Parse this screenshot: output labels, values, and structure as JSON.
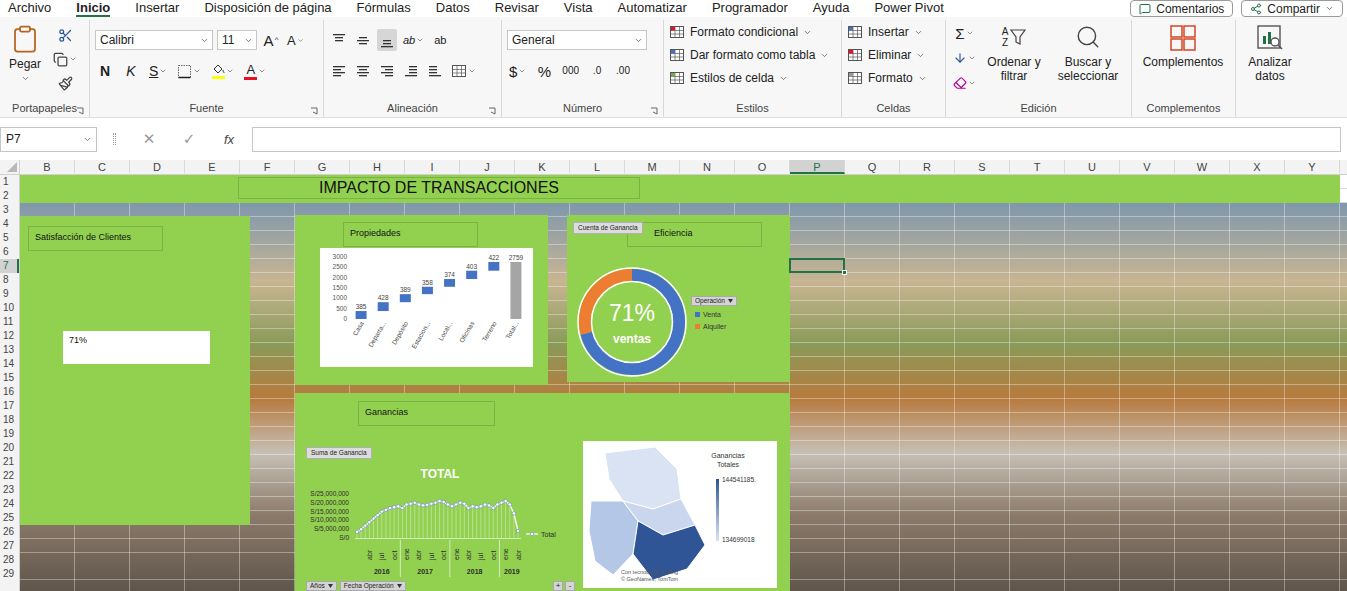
{
  "ribbon_tabs": [
    {
      "label": "Archivo",
      "selected": false
    },
    {
      "label": "Inicio",
      "selected": true
    },
    {
      "label": "Insertar",
      "selected": false
    },
    {
      "label": "Disposición de página",
      "selected": false
    },
    {
      "label": "Fórmulas",
      "selected": false
    },
    {
      "label": "Datos",
      "selected": false
    },
    {
      "label": "Revisar",
      "selected": false
    },
    {
      "label": "Vista",
      "selected": false
    },
    {
      "label": "Automatizar",
      "selected": false
    },
    {
      "label": "Programador",
      "selected": false
    },
    {
      "label": "Ayuda",
      "selected": false
    },
    {
      "label": "Power Pivot",
      "selected": false
    }
  ],
  "top_buttons": [
    "Comentarios",
    "Compartir"
  ],
  "ribbon": {
    "clipboard": {
      "label": "Portapapeles",
      "paste": "Pegar"
    },
    "font": {
      "label": "Fuente",
      "family": "Calibri",
      "size": "11",
      "grow": "A",
      "shrink": "A",
      "bold": "N",
      "italic": "K",
      "underline": "S",
      "color_letter": "A"
    },
    "alignment": {
      "label": "Alineación",
      "orientation": "ab",
      "wrap": "ab"
    },
    "number": {
      "label": "Número",
      "format": "General",
      "currency": "$",
      "percent": "%",
      "thousands": "000",
      "inc_decimal": ".0",
      "dec_decimal": ".00"
    },
    "styles": {
      "label": "Estilos",
      "items": [
        "Formato condicional",
        "Dar formato como tabla",
        "Estilos de celda"
      ]
    },
    "cells": {
      "label": "Celdas",
      "items": [
        "Insertar",
        "Eliminar",
        "Formato"
      ]
    },
    "editing": {
      "label": "Edición",
      "sum": "Σ",
      "sort_letters": [
        "A",
        "Z"
      ],
      "sort": "Ordenar y filtrar",
      "find": "Buscar y seleccionar"
    },
    "addins": {
      "label": "Complementos",
      "button": "Complementos"
    },
    "analyze": {
      "button": "Analizar datos"
    }
  },
  "formula_bar": {
    "name_box": "P7",
    "cancel": "✕",
    "enter": "✓",
    "fx": "fx",
    "value": ""
  },
  "sheet": {
    "columns": [
      {
        "label": "B",
        "selected": false
      },
      {
        "label": "C",
        "selected": false
      },
      {
        "label": "D",
        "selected": false
      },
      {
        "label": "E",
        "selected": false
      },
      {
        "label": "F",
        "selected": false
      },
      {
        "label": "G",
        "selected": false
      },
      {
        "label": "H",
        "selected": false
      },
      {
        "label": "I",
        "selected": false
      },
      {
        "label": "J",
        "selected": false
      },
      {
        "label": "K",
        "selected": false
      },
      {
        "label": "L",
        "selected": false
      },
      {
        "label": "M",
        "selected": false
      },
      {
        "label": "N",
        "selected": false
      },
      {
        "label": "O",
        "selected": false
      },
      {
        "label": "P",
        "selected": true
      },
      {
        "label": "Q",
        "selected": false
      },
      {
        "label": "R",
        "selected": false
      },
      {
        "label": "S",
        "selected": false
      },
      {
        "label": "T",
        "selected": false
      },
      {
        "label": "U",
        "selected": false
      },
      {
        "label": "V",
        "selected": false
      },
      {
        "label": "W",
        "selected": false
      },
      {
        "label": "X",
        "selected": false
      },
      {
        "label": "Y",
        "selected": false
      }
    ],
    "rows": [
      {
        "label": "1",
        "selected": false
      },
      {
        "label": "2",
        "selected": false
      },
      {
        "label": "3",
        "selected": false
      },
      {
        "label": "4",
        "selected": false
      },
      {
        "label": "5",
        "selected": false
      },
      {
        "label": "6",
        "selected": false
      },
      {
        "label": "7",
        "selected": true
      },
      {
        "label": "8",
        "selected": false
      },
      {
        "label": "9",
        "selected": false
      },
      {
        "label": "10",
        "selected": false
      },
      {
        "label": "11",
        "selected": false
      },
      {
        "label": "12",
        "selected": false
      },
      {
        "label": "13",
        "selected": false
      },
      {
        "label": "14",
        "selected": false
      },
      {
        "label": "15",
        "selected": false
      },
      {
        "label": "16",
        "selected": false
      },
      {
        "label": "17",
        "selected": false
      },
      {
        "label": "18",
        "selected": false
      },
      {
        "label": "19",
        "selected": false
      },
      {
        "label": "20",
        "selected": false
      },
      {
        "label": "21",
        "selected": false
      },
      {
        "label": "22",
        "selected": false
      },
      {
        "label": "23",
        "selected": false
      },
      {
        "label": "24",
        "selected": false
      },
      {
        "label": "25",
        "selected": false
      },
      {
        "label": "26",
        "selected": false
      },
      {
        "label": "27",
        "selected": false
      },
      {
        "label": "28",
        "selected": false
      },
      {
        "label": "29",
        "selected": false
      }
    ]
  },
  "dashboard": {
    "title": "IMPACTO DE TRANSACCIONES",
    "satisfaction": {
      "title": "Satisfacción de Clientes",
      "value": "71%"
    },
    "properties": {
      "title": "Propiedades",
      "y_max": 3000,
      "y_ticks": [
        "0",
        "500",
        "1000",
        "1500",
        "2000",
        "2500",
        "3000"
      ],
      "bars": [
        {
          "category": "Casa",
          "label": "385",
          "value": 385,
          "kind": "increase"
        },
        {
          "category": "Departa...",
          "label": "428",
          "value": 428,
          "kind": "increase"
        },
        {
          "category": "Depósito",
          "label": "389",
          "value": 389,
          "kind": "increase"
        },
        {
          "category": "Estacion...",
          "label": "358",
          "value": 358,
          "kind": "increase"
        },
        {
          "category": "Local...",
          "label": "374",
          "value": 374,
          "kind": "increase"
        },
        {
          "category": "Oficinas",
          "label": "403",
          "value": 403,
          "kind": "increase"
        },
        {
          "category": "Terreno",
          "label": "422",
          "value": 422,
          "kind": "increase"
        },
        {
          "category": "Total...",
          "label": "2759",
          "value": 2759,
          "kind": "total"
        }
      ]
    },
    "efficiency": {
      "title": "Eficiencia",
      "field_button": "Cuenta de Ganancia",
      "center_value": "71%",
      "center_label": "ventas",
      "legend_title": "Operación",
      "slices": [
        {
          "label": "Venta",
          "value": 0.71,
          "color": "#4472c4"
        },
        {
          "label": "Alquiler",
          "value": 0.29,
          "color": "#ed7d31"
        }
      ]
    },
    "earnings": {
      "title": "Ganancias",
      "field_button": "Suma de Ganancia",
      "chart_title": "TOTAL",
      "legend": "Total",
      "y_max": 25000000,
      "y_ticks": [
        "S/0",
        "S/5,000,000",
        "S/10,000,000",
        "S/15,000,000",
        "S/20,000,000",
        "S/25,000,000"
      ],
      "values": [
        3500000,
        5000000,
        7000000,
        9000000,
        11000000,
        13000000,
        15000000,
        16000000,
        17000000,
        17500000,
        18000000,
        17000000,
        19000000,
        19500000,
        20000000,
        19000000,
        18500000,
        18800000,
        19500000,
        20000000,
        21000000,
        20500000,
        19000000,
        18000000,
        19000000,
        20000000,
        19500000,
        17000000,
        18000000,
        17500000,
        18000000,
        19000000,
        18500000,
        17000000,
        19000000,
        20000000,
        21000000,
        19000000,
        14000000,
        4000000
      ],
      "x_axis": [
        {
          "year": "2016",
          "months": [
            {
              "label": "abr",
              "point": 3
            },
            {
              "label": "jul",
              "point": 6
            },
            {
              "label": "oct",
              "point": 9
            }
          ]
        },
        {
          "year": "2017",
          "months": [
            {
              "label": "ene",
              "point": 12
            },
            {
              "label": "abr",
              "point": 15
            },
            {
              "label": "jul",
              "point": 18
            },
            {
              "label": "oct",
              "point": 21
            }
          ]
        },
        {
          "year": "2018",
          "months": [
            {
              "label": "ene",
              "point": 24
            },
            {
              "label": "abr",
              "point": 27
            },
            {
              "label": "jul",
              "point": 30
            },
            {
              "label": "oct",
              "point": 33
            }
          ]
        },
        {
          "year": "2019",
          "months": [
            {
              "label": "ene",
              "point": 36
            },
            {
              "label": "abr",
              "point": 39
            }
          ]
        }
      ],
      "filters": [
        "Años",
        "Fecha Operación"
      ],
      "zoom": [
        "+",
        "-"
      ],
      "map": {
        "legend_title": "Ganancias Totales",
        "max_label": "144541185.",
        "min_label": "134699018",
        "credit": [
          "Con tecnología de Bing",
          "© GeoNames, TomTom"
        ],
        "regions": [
          {
            "color": "#dae3f3"
          },
          {
            "color": "#b4c7e7"
          },
          {
            "color": "#c9d6ee"
          },
          {
            "color": "#2f5597"
          }
        ]
      }
    }
  }
}
